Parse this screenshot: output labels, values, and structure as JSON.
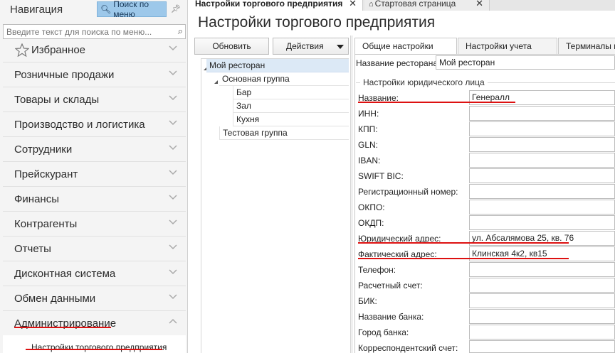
{
  "nav": {
    "title": "Навигация",
    "search_button": "Поиск по меню",
    "search_placeholder": "Введите текст для поиска по меню...",
    "items": [
      {
        "label": "Избранное"
      },
      {
        "label": "Розничные продажи"
      },
      {
        "label": "Товары и склады"
      },
      {
        "label": "Производство и логистика"
      },
      {
        "label": "Сотрудники"
      },
      {
        "label": "Прейскурант"
      },
      {
        "label": "Финансы"
      },
      {
        "label": "Контрагенты"
      },
      {
        "label": "Отчеты"
      },
      {
        "label": "Дисконтная система"
      },
      {
        "label": "Обмен данными"
      },
      {
        "label": "Администрирование"
      }
    ],
    "subitem": "Настройки торгового предприятия"
  },
  "tabs": [
    {
      "label": "Настройки торгового предприятия"
    },
    {
      "label": "Стартовая страница"
    }
  ],
  "page": {
    "title": "Настройки торгового предприятия"
  },
  "toolbar": {
    "refresh": "Обновить",
    "actions": "Действия"
  },
  "tree": {
    "root": "Мой ресторан",
    "main_group": "Основная группа",
    "bar": "Бар",
    "hall": "Зал",
    "kitchen": "Кухня",
    "test_group": "Тестовая группа"
  },
  "settings_tabs": [
    {
      "label": "Общие настройки"
    },
    {
      "label": "Настройки учета"
    },
    {
      "label": "Терминалы и у"
    }
  ],
  "restaurant": {
    "label": "Название ресторана:",
    "value": "Мой ресторан"
  },
  "legal": {
    "group_title": "Настройки юридического лица",
    "fields": [
      {
        "label": "Название:",
        "value": "Генералл"
      },
      {
        "label": "ИНН:",
        "value": ""
      },
      {
        "label": "КПП:",
        "value": ""
      },
      {
        "label": "GLN:",
        "value": ""
      },
      {
        "label": "IBAN:",
        "value": ""
      },
      {
        "label": "SWIFT BIC:",
        "value": ""
      },
      {
        "label": "Регистрационный номер:",
        "value": ""
      },
      {
        "label": "ОКПО:",
        "value": ""
      },
      {
        "label": "ОКДП:",
        "value": ""
      },
      {
        "label": "Юридический адрес:",
        "value": "ул. Абсалямова 25, кв. 76"
      },
      {
        "label": "Фактический адрес:",
        "value": "Клинская 4к2, кв15"
      },
      {
        "label": "Телефон:",
        "value": ""
      },
      {
        "label": "Расчетный счет:",
        "value": ""
      },
      {
        "label": "БИК:",
        "value": ""
      },
      {
        "label": "Название банка:",
        "value": ""
      },
      {
        "label": "Город банка:",
        "value": ""
      },
      {
        "label": "Корреспондентский счет:",
        "value": ""
      }
    ]
  },
  "colors": {
    "accent": "#9dc8ea",
    "highlight_underline": "#dd1111",
    "selected_row": "#dce9f6"
  },
  "icons": [
    "search-icon",
    "pin-icon",
    "star-icon",
    "chevron-down-icon",
    "chevron-up-icon",
    "close-icon",
    "home-icon",
    "caret-down-icon",
    "expand-triangle-icon"
  ]
}
